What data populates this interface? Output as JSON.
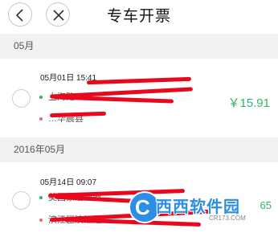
{
  "navbar": {
    "title": "专车开票",
    "back_icon": "chevron-left-icon",
    "close_icon": "close-icon"
  },
  "sections": [
    {
      "header": "05月",
      "item": {
        "datetime": "05月01日 15:41",
        "from": "上海路…",
        "to": "…华晨县",
        "price": "￥15.91"
      }
    },
    {
      "header": "2016年05月",
      "item": {
        "datetime": "05月14日 09:07",
        "from": "美国象汪去掉…",
        "to": "滨江区滨江路…",
        "price": "65"
      }
    }
  ],
  "watermark": {
    "brand": "西西软件园",
    "url": "CR173.COM"
  },
  "colors": {
    "accent_green": "#34b36b",
    "redaction_red": "#e8091f",
    "section_bg": "#f2f2f2"
  }
}
